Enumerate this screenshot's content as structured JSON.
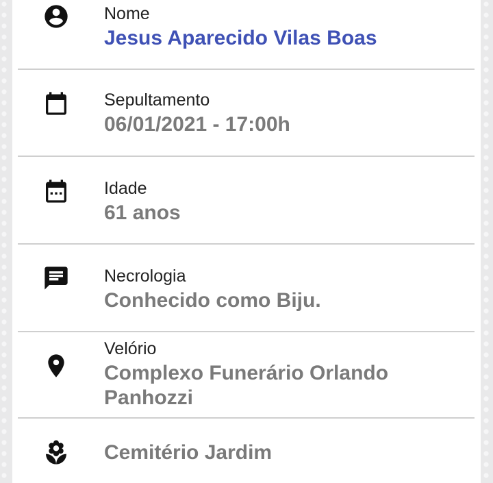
{
  "fields": {
    "nome": {
      "label": "Nome",
      "value": "Jesus Aparecido Vilas Boas",
      "icon": "account-circle-icon"
    },
    "sepultamento": {
      "label": "Sepultamento",
      "value": "06/01/2021 - 17:00h",
      "icon": "calendar-icon"
    },
    "idade": {
      "label": "Idade",
      "value": "61 anos",
      "icon": "calendar-dots-icon"
    },
    "necrologia": {
      "label": "Necrologia",
      "value": "Conhecido como Biju.",
      "icon": "message-icon"
    },
    "velorio": {
      "label": "Velório",
      "value": "Complexo Funerário Orlando Panhozzi",
      "icon": "map-pin-icon"
    },
    "cemiterio": {
      "value": "Cemitério Jardim",
      "icon": "flower-icon"
    }
  },
  "colors": {
    "accent": "#3f51b5",
    "value_text": "#7a7a7a",
    "label_text": "#222222",
    "divider": "#cfcfcf"
  }
}
